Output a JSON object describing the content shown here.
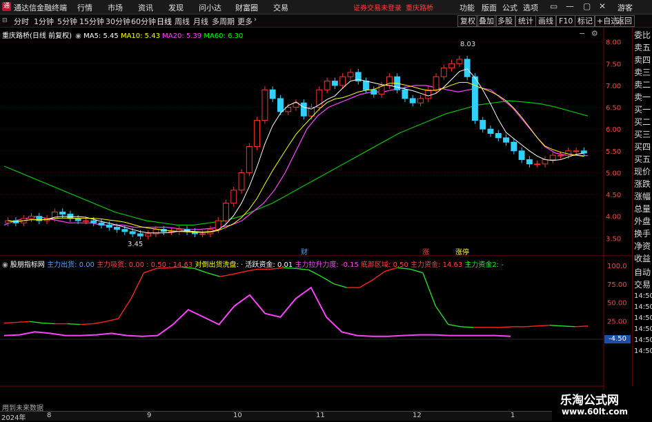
{
  "app": {
    "title": "通达信金融终端",
    "menus": [
      "行情",
      "市场",
      "资讯",
      "发现",
      "问小达",
      "财富圈",
      "交易"
    ],
    "notice": "证券交易未登录",
    "notice_stock": "重庆路桥",
    "right_menus": [
      "功能",
      "版面",
      "公式",
      "选项"
    ],
    "user": "游客"
  },
  "periods": {
    "items": [
      "分时",
      "1分钟",
      "5分钟",
      "15分钟",
      "30分钟",
      "60分钟",
      "日线",
      "周线",
      "月线",
      "多周期",
      "更多"
    ],
    "active": "日线",
    "tools": [
      "复权",
      "叠加",
      "多股",
      "统计",
      "画线",
      "F10",
      "标记",
      "+自选",
      "返回"
    ]
  },
  "stock": {
    "name": "重庆路桥(日线 前复权)",
    "ma": [
      {
        "label": "MA5: 5.45",
        "color": "#ffffff"
      },
      {
        "label": "MA10: 5.43",
        "color": "#ffff00"
      },
      {
        "label": "MA20: 5.39",
        "color": "#ff40ff"
      },
      {
        "label": "MA60: 6.30",
        "color": "#00ff00"
      }
    ],
    "high_label": "8.03",
    "low_label": "3.45",
    "events": [
      {
        "label": "财",
        "color": "#4aa3ff"
      },
      {
        "label": "涨",
        "color": "#ff4040"
      },
      {
        "label": "涨停",
        "color": "#ffff40"
      }
    ]
  },
  "main_axis": {
    "ticks": [
      "8.00",
      "7.50",
      "7.00",
      "6.50",
      "6.00",
      "5.50",
      "5.00",
      "4.50",
      "4.00",
      "3.50"
    ]
  },
  "indicator": {
    "name": "股朋指标网",
    "items": [
      {
        "label": "主力出货: 0.00",
        "color": "#4aa3ff"
      },
      {
        "label": "主力吸货: 0.00 : 0.50 : 14.63",
        "color": "#ff4040"
      },
      {
        "label": "对倒出货洗盘: ·",
        "color": "#ffff00"
      },
      {
        "label": "活跃资金: 0.01",
        "color": "#ffffff"
      },
      {
        "label": "主力拉升力度: -0.15",
        "color": "#ff40ff"
      },
      {
        "label": "底部区域: 0.50",
        "color": "#ff4040"
      },
      {
        "label": "主力资金: 14.63",
        "color": "#ff4040"
      },
      {
        "label": "主力资金2: -",
        "color": "#00ff00"
      }
    ],
    "ticks": [
      "100.0",
      "75.00",
      "50.00",
      "25.00"
    ],
    "current": "-4.50",
    "right_vals": [
      "14:50",
      "14:50",
      "14:50",
      "14:50",
      "14:50",
      "14:50"
    ]
  },
  "sidebar": {
    "items": [
      "委比",
      "卖五",
      "卖四",
      "卖三",
      "卖二",
      "卖一",
      "买一",
      "买二",
      "买三",
      "买四",
      "买五",
      "现价",
      "涨跌",
      "涨幅",
      "总量",
      "外盘",
      "换手",
      "净资",
      "收益",
      "自动",
      "交易"
    ]
  },
  "xaxis": {
    "year": "2024年",
    "months": [
      "8",
      "9",
      "10",
      "11",
      "12",
      "1"
    ]
  },
  "bottom": {
    "hint": "用到未来数据"
  },
  "watermark": {
    "cn": "乐淘公式网",
    "url": "www.60lt.com"
  },
  "chart_data": {
    "type": "candlestick",
    "price_range": [
      3.3,
      8.2
    ],
    "closes": [
      3.9,
      3.85,
      3.95,
      4.0,
      3.9,
      3.95,
      4.1,
      4.05,
      3.95,
      3.9,
      3.9,
      3.85,
      3.8,
      3.75,
      3.7,
      3.65,
      3.6,
      3.55,
      3.6,
      3.7,
      3.65,
      3.65,
      3.7,
      3.65,
      3.6,
      3.6,
      3.7,
      3.9,
      4.3,
      4.6,
      5.0,
      5.6,
      6.2,
      6.9,
      6.7,
      6.4,
      6.5,
      6.6,
      6.3,
      6.5,
      6.9,
      7.1,
      7.0,
      7.2,
      7.3,
      7.1,
      6.9,
      6.8,
      7.0,
      7.2,
      6.9,
      6.7,
      6.6,
      6.7,
      6.9,
      7.2,
      7.4,
      7.5,
      7.6,
      7.2,
      6.2,
      6.0,
      5.9,
      5.8,
      5.7,
      5.5,
      5.3,
      5.2,
      5.2,
      5.3,
      5.4,
      5.4,
      5.5,
      5.5,
      5.45
    ],
    "ma20": [
      3.8,
      3.9,
      3.95,
      4.0,
      3.95,
      3.9,
      3.85,
      3.85,
      3.85,
      3.8,
      3.8,
      3.8,
      3.75,
      3.75,
      3.75,
      3.75,
      3.72,
      3.7,
      3.7,
      3.72,
      3.75,
      3.8,
      3.9,
      4.1,
      4.3,
      4.6,
      5.0,
      5.5,
      6.0,
      6.3,
      6.5,
      6.6,
      6.7,
      6.8,
      6.85,
      6.85,
      6.9,
      6.95,
      7.0,
      7.0,
      6.95,
      6.9,
      6.85,
      6.9,
      6.95,
      6.9,
      6.7,
      6.5,
      6.2,
      5.9,
      5.6,
      5.45,
      5.4,
      5.4,
      5.39
    ],
    "ma60": [
      5.15,
      5.0,
      4.85,
      4.7,
      4.55,
      4.4,
      4.25,
      4.1,
      4.0,
      3.9,
      3.85,
      3.8,
      3.8,
      3.85,
      3.9,
      4.0,
      4.15,
      4.3,
      4.5,
      4.7,
      4.9,
      5.1,
      5.3,
      5.5,
      5.7,
      5.9,
      6.05,
      6.2,
      6.35,
      6.45,
      6.55,
      6.6,
      6.65,
      6.62,
      6.58,
      6.5,
      6.4,
      6.3
    ],
    "indicator_line": [
      22,
      23,
      24,
      22,
      21,
      21,
      20,
      21,
      24,
      28,
      55,
      90,
      96,
      97,
      98,
      96,
      90,
      85,
      88,
      92,
      95,
      95,
      97,
      96,
      94,
      85,
      75,
      70,
      70,
      80,
      92,
      97,
      95,
      90,
      45,
      20,
      17,
      16,
      16,
      16,
      17,
      17,
      18,
      19,
      18,
      17,
      18
    ],
    "indicator_pink": [
      5,
      6,
      10,
      8,
      5,
      5,
      6,
      8,
      5,
      4,
      5,
      20,
      40,
      30,
      20,
      45,
      60,
      35,
      30,
      55,
      70,
      30,
      10,
      5,
      4,
      4,
      5,
      6,
      6,
      5,
      5,
      5,
      5,
      4
    ]
  }
}
